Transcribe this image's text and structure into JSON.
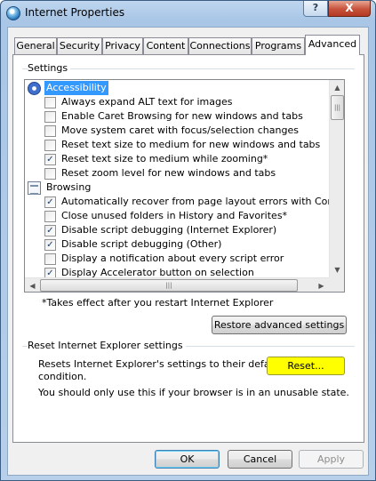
{
  "window": {
    "title": "Internet Properties",
    "help_glyph": "?",
    "close_glyph": "X"
  },
  "tabs": [
    {
      "label": "General"
    },
    {
      "label": "Security"
    },
    {
      "label": "Privacy"
    },
    {
      "label": "Content"
    },
    {
      "label": "Connections"
    },
    {
      "label": "Programs"
    },
    {
      "label": "Advanced"
    }
  ],
  "active_tab": "Advanced",
  "settings": {
    "group_label": "Settings",
    "rows": [
      {
        "kind": "category",
        "label": "Accessibility",
        "icon": "accessibility-icon",
        "selected": true
      },
      {
        "kind": "option",
        "label": "Always expand ALT text for images",
        "checked": false
      },
      {
        "kind": "option",
        "label": "Enable Caret Browsing for new windows and tabs",
        "checked": false
      },
      {
        "kind": "option",
        "label": "Move system caret with focus/selection changes",
        "checked": false
      },
      {
        "kind": "option",
        "label": "Reset text size to medium for new windows and tabs",
        "checked": false
      },
      {
        "kind": "option",
        "label": "Reset text size to medium while zooming*",
        "checked": true
      },
      {
        "kind": "option",
        "label": "Reset zoom level for new windows and tabs",
        "checked": false
      },
      {
        "kind": "category",
        "label": "Browsing",
        "icon": "browsing-icon",
        "selected": false
      },
      {
        "kind": "option",
        "label": "Automatically recover from page layout errors with Compa",
        "checked": true
      },
      {
        "kind": "option",
        "label": "Close unused folders in History and Favorites*",
        "checked": false
      },
      {
        "kind": "option",
        "label": "Disable script debugging (Internet Explorer)",
        "checked": true
      },
      {
        "kind": "option",
        "label": "Disable script debugging (Other)",
        "checked": true
      },
      {
        "kind": "option",
        "label": "Display a notification about every script error",
        "checked": false
      },
      {
        "kind": "option",
        "label": "Display Accelerator button on selection",
        "checked": true
      }
    ],
    "scroll_glyphs": {
      "up": "▲",
      "down": "▼",
      "left": "◀",
      "right": "▶",
      "grip": "|||"
    },
    "restart_note": "*Takes effect after you restart Internet Explorer",
    "restore_button": "Restore advanced settings"
  },
  "reset_section": {
    "group_label": "Reset Internet Explorer settings",
    "description_line1": "Resets Internet Explorer's settings to their default",
    "description_line2": "condition.",
    "reset_button": "Reset...",
    "warning": "You should only use this if your browser is in an unusable state."
  },
  "footer": {
    "ok": "OK",
    "cancel": "Cancel",
    "apply": "Apply"
  },
  "checkmark_glyph": "✓"
}
